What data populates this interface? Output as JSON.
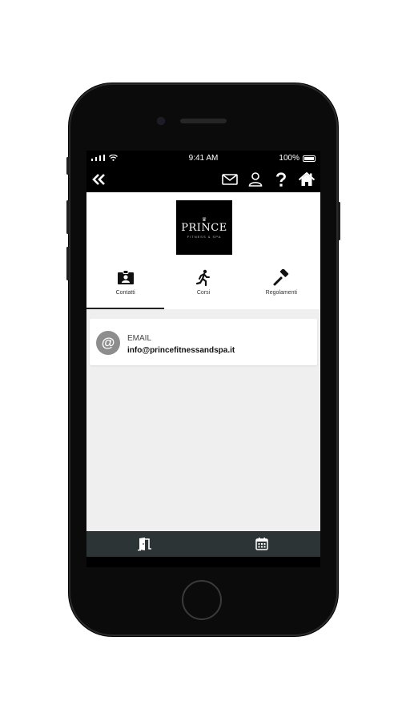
{
  "status_bar": {
    "time": "9:41 AM",
    "battery": "100%",
    "icons": [
      "signal-icon",
      "wifi-icon",
      "battery-icon"
    ]
  },
  "nav": {
    "back_icon": "double-chevron-left-icon",
    "icons": [
      "mail-icon",
      "user-icon",
      "help-icon",
      "home-icon"
    ]
  },
  "logo": {
    "text": "PRINCE",
    "subtext": "FITNESS & SPA"
  },
  "tabs": [
    {
      "label": "Contatti",
      "icon": "contact-card-icon",
      "active": true
    },
    {
      "label": "Corsi",
      "icon": "running-icon",
      "active": false
    },
    {
      "label": "Regolamenti",
      "icon": "gavel-icon",
      "active": false
    }
  ],
  "contact_card": {
    "icon": "at-icon",
    "avatar_symbol": "@",
    "label": "EMAIL",
    "value": "info@princefitnessandspa.it"
  },
  "bottom_bar": {
    "items": [
      "door-exit-icon",
      "calendar-icon"
    ],
    "background": "#2d3436"
  },
  "colors": {
    "nav_background": "#000000",
    "content_background": "#efefef",
    "avatar": "#8d8d8d"
  }
}
